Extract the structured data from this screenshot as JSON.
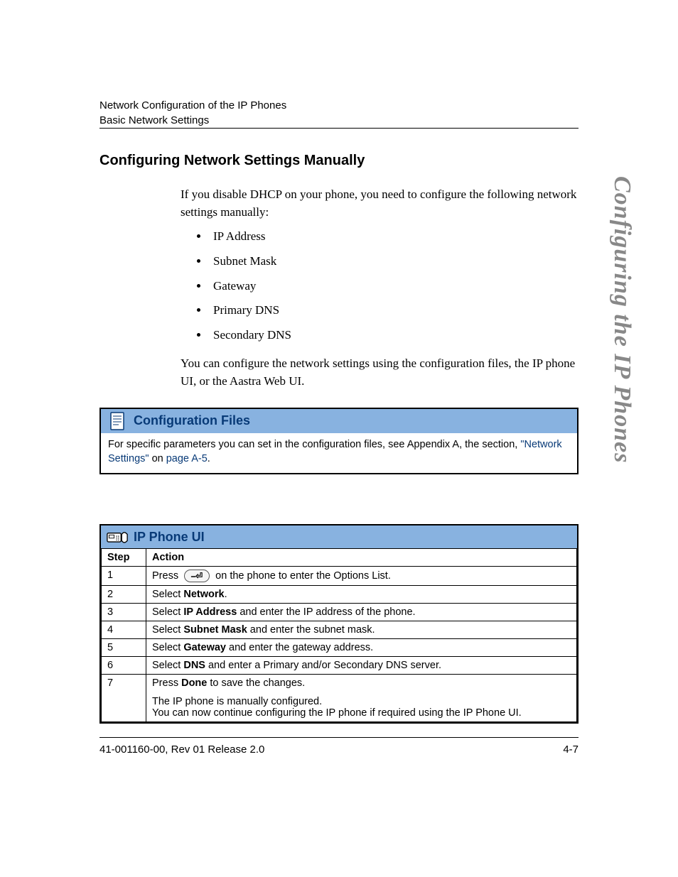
{
  "header": {
    "line1": "Network Configuration of the IP Phones",
    "line2": "Basic Network Settings"
  },
  "side_title": "Configuring the IP Phones",
  "section_title": "Configuring Network Settings Manually",
  "intro": "If you disable DHCP on your phone, you need to configure the following network settings manually:",
  "settings_list": [
    "IP Address",
    "Subnet Mask",
    "Gateway",
    "Primary DNS",
    "Secondary DNS"
  ],
  "outro": "You can configure the network settings using the configuration files, the IP phone UI, or the Aastra Web UI.",
  "config_files": {
    "title": "Configuration Files",
    "text_before": "For specific parameters you can set in the configuration files, see Appendix A, the section, ",
    "link1": "\"Network Settings\"",
    "text_mid": " on ",
    "link2": "page A-5",
    "text_after": "."
  },
  "ip_phone_ui": {
    "title": "IP Phone UI",
    "headers": {
      "step": "Step",
      "action": "Action"
    },
    "rows": [
      {
        "step": "1",
        "prefix": "Press ",
        "key": "⎯⏎",
        "suffix": " on the phone to enter the Options List."
      },
      {
        "step": "2",
        "prefix": "Select ",
        "bold": "Network",
        "suffix": "."
      },
      {
        "step": "3",
        "prefix": "Select ",
        "bold": "IP Address",
        "suffix": " and enter the IP address of the phone."
      },
      {
        "step": "4",
        "prefix": "Select ",
        "bold": "Subnet Mask",
        "suffix": " and enter the subnet mask."
      },
      {
        "step": "5",
        "prefix": "Select ",
        "bold": "Gateway",
        "suffix": " and enter the gateway address."
      },
      {
        "step": "6",
        "prefix": "Select ",
        "bold": "DNS",
        "suffix": " and enter a Primary and/or Secondary DNS server."
      },
      {
        "step": "7",
        "prefix": "Press ",
        "bold": "Done",
        "suffix": " to save the changes.",
        "note1": "The IP phone is manually configured.",
        "note2": "You can now continue configuring the IP phone if required using the IP Phone UI."
      }
    ]
  },
  "footer": {
    "left": "41-001160-00, Rev 01  Release 2.0",
    "right": "4-7"
  }
}
